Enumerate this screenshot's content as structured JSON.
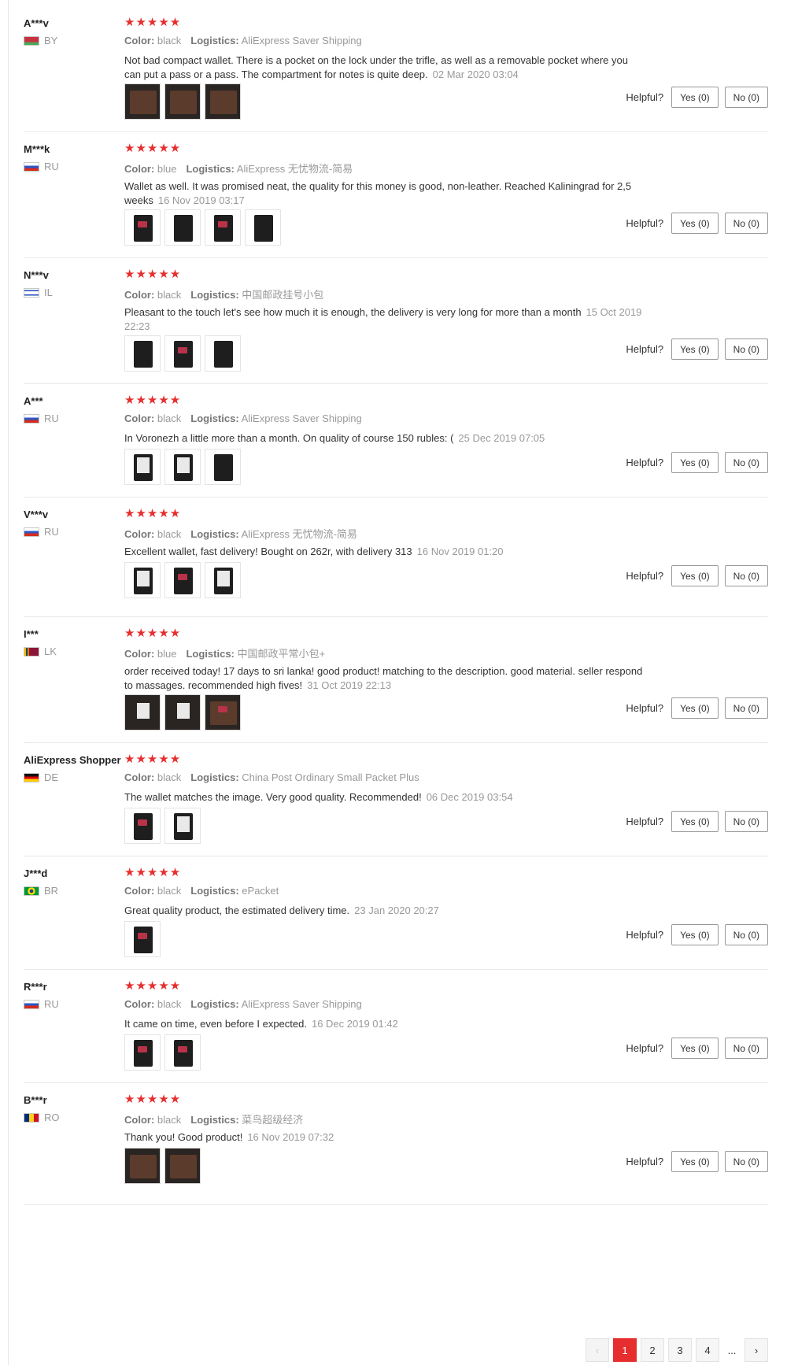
{
  "labels": {
    "color": "Color:",
    "logistics": "Logistics:",
    "helpful": "Helpful?",
    "yes": "Yes (0)",
    "no": "No (0)",
    "stars": "★★★★★"
  },
  "reviews": [
    {
      "user": "A***v",
      "country": "BY",
      "color": "black",
      "logistics": "AliExpress Saver Shipping",
      "text": "Not bad compact wallet. There is a pocket on the lock under the trifle, as well as a removable pocket where you can put a pass or a pass. The compartment for notes is quite deep.",
      "date": "02 Mar 2020 03:04"
    },
    {
      "user": "M***k",
      "country": "RU",
      "color": "blue",
      "logistics": "AliExpress 无忧物流-简易",
      "text": "Wallet as well. It was promised neat, the quality for this money is good, non-leather. Reached Kaliningrad for 2,5 weeks",
      "date": "16 Nov 2019 03:17"
    },
    {
      "user": "N***v",
      "country": "IL",
      "color": "black",
      "logistics": "中国邮政挂号小包",
      "text": "Pleasant to the touch let's see how much it is enough, the delivery is very long for more than a month",
      "date": "15 Oct 2019 22:23"
    },
    {
      "user": "A***",
      "country": "RU",
      "color": "black",
      "logistics": "AliExpress Saver Shipping",
      "text": "In Voronezh a little more than a month. On quality of course 150 rubles: (",
      "date": "25 Dec 2019 07:05"
    },
    {
      "user": "V***v",
      "country": "RU",
      "color": "black",
      "logistics": "AliExpress 无忧物流-简易",
      "text": "Excellent wallet, fast delivery! Bought on 262r, with delivery 313",
      "date": "16 Nov 2019 01:20"
    },
    {
      "user": "I***",
      "country": "LK",
      "color": "blue",
      "logistics": "中国邮政平常小包+",
      "text": "order received today! 17 days to sri lanka! good product! matching to the description. good material. seller respond to massages. recommended high fives!",
      "date": "31 Oct 2019 22:13"
    },
    {
      "user": "AliExpress Shopper",
      "country": "DE",
      "color": "black",
      "logistics": "China Post Ordinary Small Packet Plus",
      "text": "The wallet matches the image. Very good quality. Recommended!",
      "date": "06 Dec 2019 03:54"
    },
    {
      "user": "J***d",
      "country": "BR",
      "color": "black",
      "logistics": "ePacket",
      "text": "Great quality product, the estimated delivery time.",
      "date": "23 Jan 2020 20:27"
    },
    {
      "user": "R***r",
      "country": "RU",
      "color": "black",
      "logistics": "AliExpress Saver Shipping",
      "text": "It came on time, even before I expected.",
      "date": "16 Dec 2019 01:42"
    },
    {
      "user": "B***r",
      "country": "RO",
      "color": "black",
      "logistics": "菜鸟超级经济",
      "text": "Thank you! Good product!",
      "date": "16 Nov 2019 07:32"
    }
  ],
  "pagination": {
    "prev": "‹",
    "pages": [
      "1",
      "2",
      "3",
      "4"
    ],
    "ellipsis": "...",
    "next": "›",
    "current": "1"
  },
  "colors": {
    "accent": "#e62e2e",
    "meta": "#999999"
  }
}
